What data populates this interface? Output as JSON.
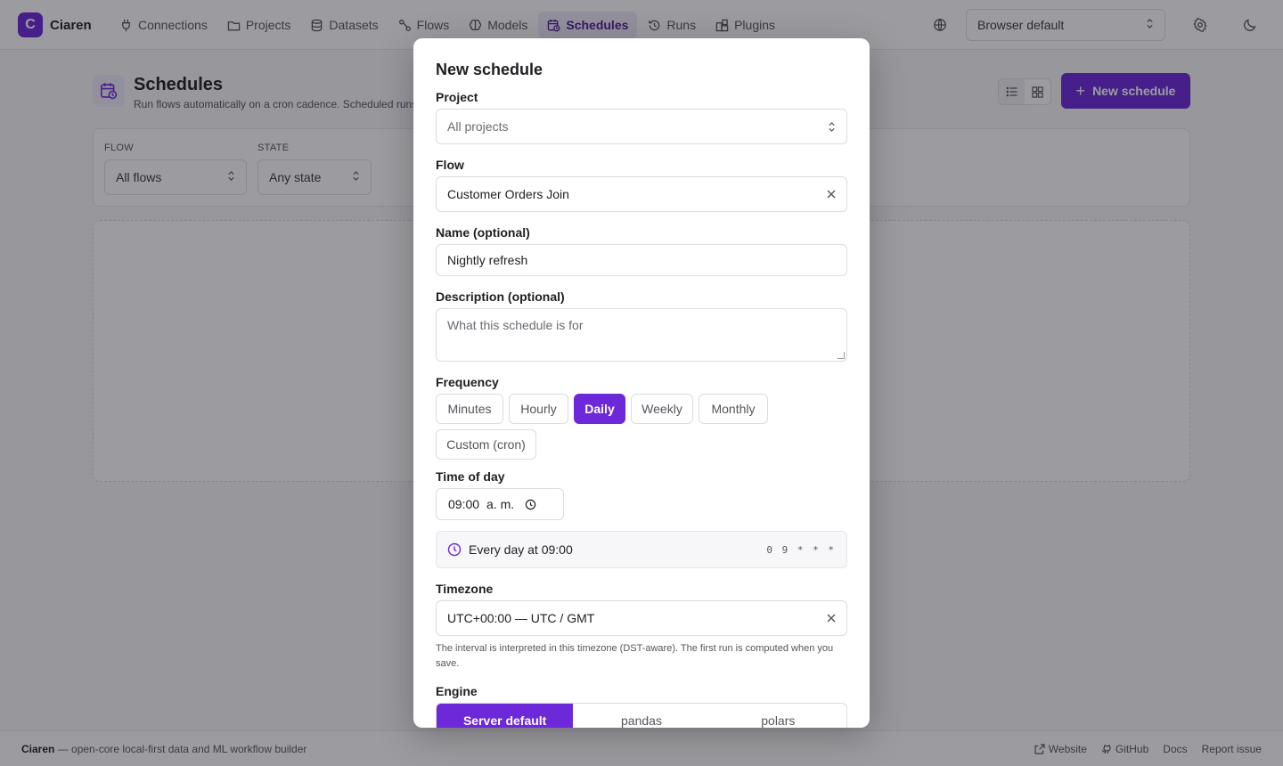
{
  "app": {
    "logo_letter": "C",
    "logo_name": "Ciaren"
  },
  "nav": {
    "items": [
      {
        "label": "Connections",
        "icon": "plug-icon"
      },
      {
        "label": "Projects",
        "icon": "folder-icon"
      },
      {
        "label": "Datasets",
        "icon": "database-icon"
      },
      {
        "label": "Flows",
        "icon": "flow-icon"
      },
      {
        "label": "Models",
        "icon": "brain-icon"
      },
      {
        "label": "Schedules",
        "icon": "calendar-clock-icon",
        "active": true
      },
      {
        "label": "Runs",
        "icon": "history-icon"
      },
      {
        "label": "Plugins",
        "icon": "puzzle-icon"
      }
    ],
    "language_value": "Browser default"
  },
  "page": {
    "title": "Schedules",
    "subtitle": "Run flows automatically on a cron cadence. Scheduled runs",
    "new_button": "New schedule"
  },
  "filters": {
    "flow_label": "FLOW",
    "flow_value": "All flows",
    "state_label": "STATE",
    "state_value": "Any state"
  },
  "modal": {
    "title": "New schedule",
    "project_label": "Project",
    "project_value": "All projects",
    "flow_label": "Flow",
    "flow_value": "Customer Orders Join",
    "name_label": "Name (optional)",
    "name_value": "Nightly refresh",
    "description_label": "Description (optional)",
    "description_placeholder": "What this schedule is for",
    "frequency_label": "Frequency",
    "frequency_options": [
      "Minutes",
      "Hourly",
      "Daily",
      "Weekly",
      "Monthly",
      "Custom (cron)"
    ],
    "frequency_selected": "Daily",
    "time_label": "Time of day",
    "time_value": "09:00",
    "time_period": "a. m.",
    "summary_text": "Every day at 09:00",
    "summary_cron": "0 9 * * *",
    "timezone_label": "Timezone",
    "timezone_value": "UTC+00:00 — UTC / GMT",
    "timezone_hint": "The interval is interpreted in this timezone (DST-aware). The first run is computed when you save.",
    "engine_label": "Engine",
    "engine_options": [
      "Server default",
      "pandas",
      "polars"
    ],
    "engine_selected": "Server default"
  },
  "footer": {
    "brand": "Ciaren",
    "tagline": " — open-core local-first data and ML workflow builder",
    "links": [
      "Website",
      "GitHub",
      "Docs",
      "Report issue"
    ]
  },
  "colors": {
    "accent": "#6d28d9",
    "accent_soft": "#efeafc"
  }
}
